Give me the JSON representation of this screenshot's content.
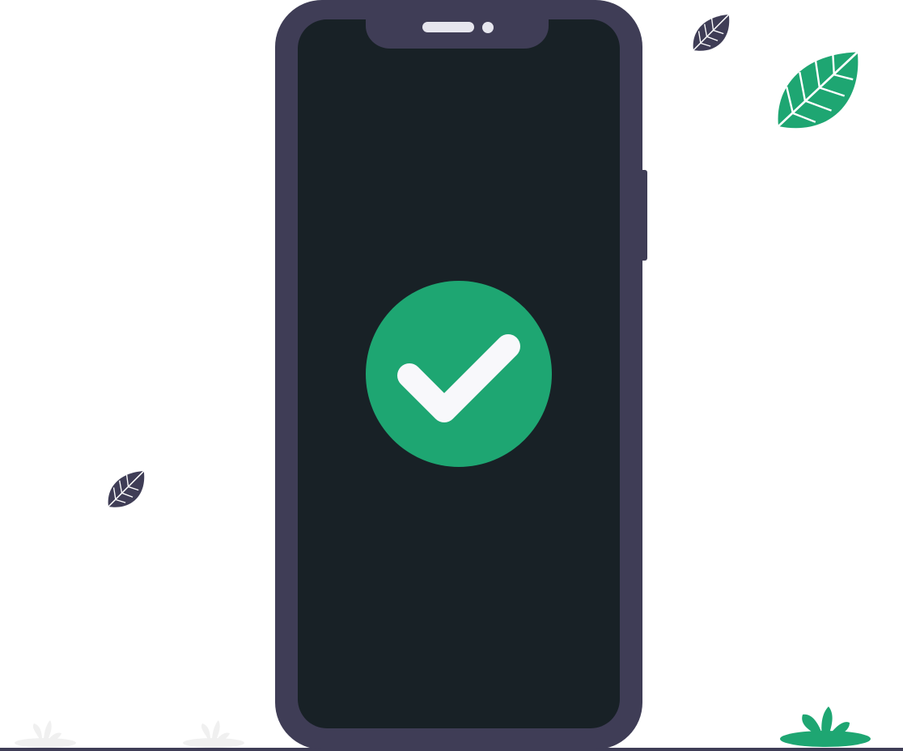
{
  "illustration": {
    "subject": "smartphone-success-check",
    "icons": [
      "check-icon",
      "leaf-icon",
      "grass-tuft-icon",
      "speaker-icon",
      "camera-icon"
    ]
  },
  "colors": {
    "background": "#ffffff",
    "phone_body": "#3f3d56",
    "phone_screen": "#182126",
    "accent_green": "#1ea672",
    "check_mark": "#f8f8fb",
    "leaf_dark": "#3f3d56",
    "grass_light": "#f0f0f0",
    "ground_line": "#3f3d56",
    "notch_detail": "#e6e6ee"
  }
}
